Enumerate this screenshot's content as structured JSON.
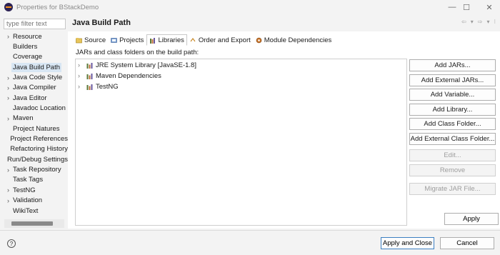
{
  "window": {
    "title": "Properties for BStackDemo"
  },
  "filter": {
    "placeholder": "type filter text"
  },
  "nav": {
    "items": [
      {
        "label": "Resource",
        "expandable": true
      },
      {
        "label": "Builders",
        "expandable": false
      },
      {
        "label": "Coverage",
        "expandable": false
      },
      {
        "label": "Java Build Path",
        "expandable": false,
        "selected": true
      },
      {
        "label": "Java Code Style",
        "expandable": true
      },
      {
        "label": "Java Compiler",
        "expandable": true
      },
      {
        "label": "Java Editor",
        "expandable": true
      },
      {
        "label": "Javadoc Location",
        "expandable": false
      },
      {
        "label": "Maven",
        "expandable": true
      },
      {
        "label": "Project Natures",
        "expandable": false
      },
      {
        "label": "Project References",
        "expandable": false
      },
      {
        "label": "Refactoring History",
        "expandable": false
      },
      {
        "label": "Run/Debug Settings",
        "expandable": false
      },
      {
        "label": "Task Repository",
        "expandable": true
      },
      {
        "label": "Task Tags",
        "expandable": false
      },
      {
        "label": "TestNG",
        "expandable": true
      },
      {
        "label": "Validation",
        "expandable": true
      },
      {
        "label": "WikiText",
        "expandable": false
      }
    ]
  },
  "panel": {
    "title": "Java Build Path",
    "tabs": [
      {
        "label": "Source",
        "icon": "source-folder-icon"
      },
      {
        "label": "Projects",
        "icon": "projects-icon"
      },
      {
        "label": "Libraries",
        "icon": "libraries-icon",
        "active": true
      },
      {
        "label": "Order and Export",
        "icon": "order-export-icon"
      },
      {
        "label": "Module Dependencies",
        "icon": "module-dependencies-icon"
      }
    ],
    "content_label": "JARs and class folders on the build path:",
    "tree": [
      {
        "label": "JRE System Library [JavaSE-1.8]"
      },
      {
        "label": "Maven Dependencies"
      },
      {
        "label": "TestNG"
      }
    ],
    "buttons": [
      {
        "label": "Add JARs...",
        "enabled": true
      },
      {
        "label": "Add External JARs...",
        "enabled": true
      },
      {
        "label": "Add Variable...",
        "enabled": true
      },
      {
        "label": "Add Library...",
        "enabled": true
      },
      {
        "label": "Add Class Folder...",
        "enabled": true
      },
      {
        "label": "Add External Class Folder...",
        "enabled": true
      },
      {
        "label": "Edit...",
        "enabled": false
      },
      {
        "label": "Remove",
        "enabled": false
      },
      {
        "label": "Migrate JAR File...",
        "enabled": false
      }
    ],
    "apply_label": "Apply"
  },
  "footer": {
    "help_label": "?",
    "apply_close_label": "Apply and Close",
    "cancel_label": "Cancel"
  },
  "colors": {
    "selection": "#d8e6f3",
    "primary_border": "#3c7fc1"
  }
}
